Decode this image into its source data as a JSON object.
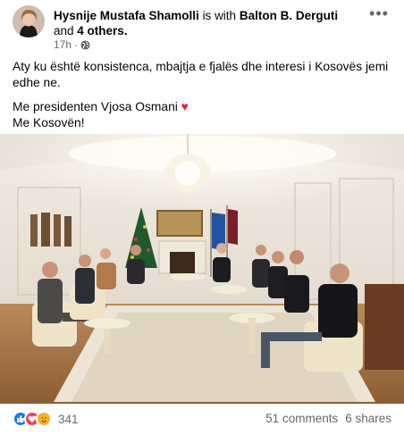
{
  "post": {
    "author": "Hysnije Mustafa Shamolli",
    "with_text": "is with",
    "tagged": "Balton B. Derguti",
    "and_text": "and",
    "others": "4 others.",
    "time": "17h",
    "privacy_icon": "globe-icon",
    "more_icon": "more-horizontal-icon",
    "paragraph1": "Aty ku është konsistenca, mbajtja e fjalës dhe interesi i Kosovës jemi edhe ne.",
    "line2": "Me presidenten Vjosa Osmani",
    "heart": "♥",
    "line3": "Me Kosovën!"
  },
  "photo": {
    "description_icon": "photo-image"
  },
  "footer": {
    "reaction_icons": [
      "like-icon",
      "love-icon",
      "care-icon"
    ],
    "reaction_count": "341",
    "comments": "51 comments",
    "shares": "6 shares"
  },
  "colors": {
    "text": "#050505",
    "secondary": "#65676b",
    "like": "#1877f2",
    "love": "#f33e58",
    "care": "#f7b125"
  }
}
